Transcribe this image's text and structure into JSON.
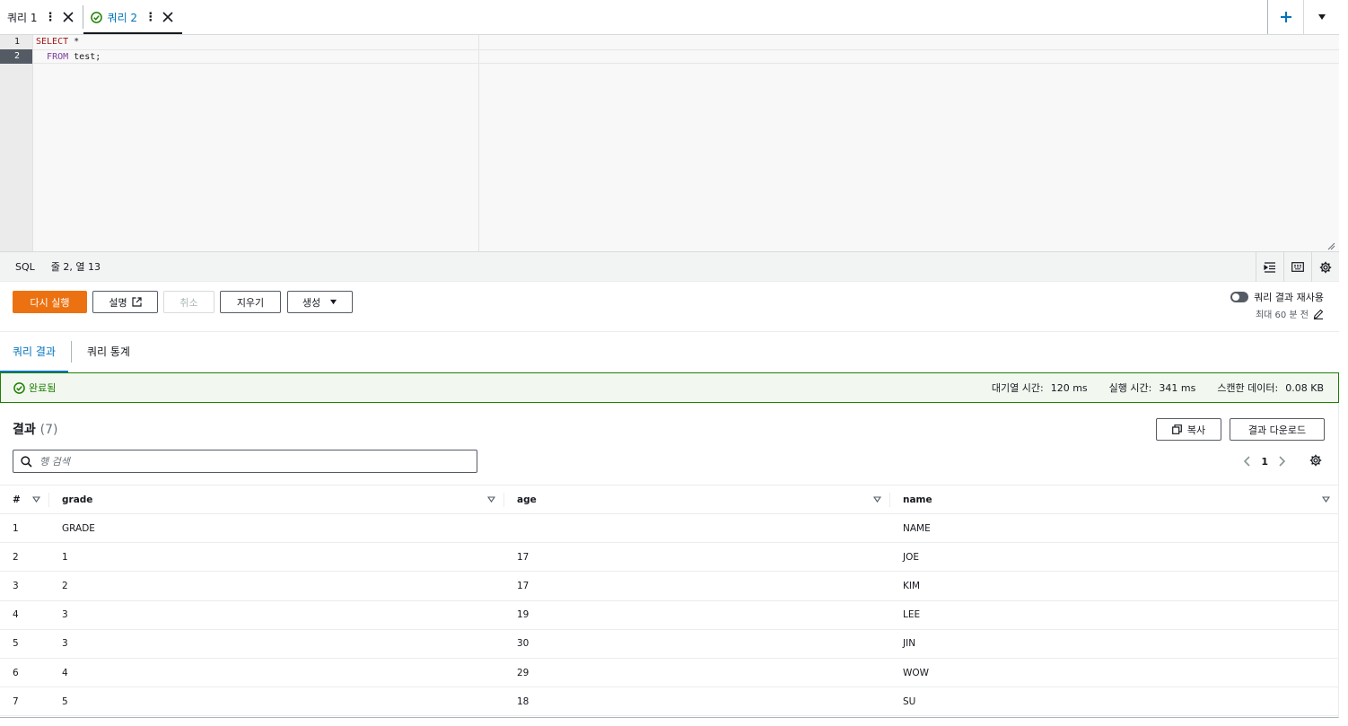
{
  "tabs": [
    {
      "label": "쿼리 1",
      "active": false
    },
    {
      "label": "쿼리 2",
      "active": true
    }
  ],
  "editor": {
    "line_numbers": [
      "1",
      "2"
    ],
    "line1_keyword": "SELECT",
    "line1_rest": " *",
    "line2_indent": "  ",
    "line2_keyword": "FROM",
    "line2_rest": " test;"
  },
  "statusbar": {
    "language": "SQL",
    "cursor": "줄 2, 열 13"
  },
  "actions": {
    "run_again": "다시 실행",
    "explain": "설명",
    "cancel": "취소",
    "clear": "지우기",
    "create": "생성"
  },
  "reuse": {
    "label": "쿼리 결과 재사용",
    "max_age": "최대 60 분 전"
  },
  "result_tabs": {
    "results": "쿼리 결과",
    "stats": "쿼리 통계"
  },
  "banner": {
    "status": "완료됨",
    "queue_label": "대기열 시간:",
    "queue_value": "120 ms",
    "run_label": "실행 시간:",
    "run_value": "341 ms",
    "scan_label": "스캔한 데이터:",
    "scan_value": "0.08 KB"
  },
  "results": {
    "title": "결과",
    "count": "(7)",
    "copy": "복사",
    "download": "결과 다운로드",
    "search_placeholder": "행 검색",
    "page": "1"
  },
  "table": {
    "columns": [
      "#",
      "grade",
      "age",
      "name"
    ],
    "rows": [
      [
        "1",
        "GRADE",
        "",
        "NAME"
      ],
      [
        "2",
        "1",
        "17",
        "JOE"
      ],
      [
        "3",
        "2",
        "17",
        "KIM"
      ],
      [
        "4",
        "3",
        "19",
        "LEE"
      ],
      [
        "5",
        "3",
        "30",
        "JIN"
      ],
      [
        "6",
        "4",
        "29",
        "WOW"
      ],
      [
        "7",
        "5",
        "18",
        "SU"
      ]
    ]
  },
  "colors": {
    "primary": "#ec7211",
    "link": "#0073bb",
    "success": "#1d8102"
  }
}
